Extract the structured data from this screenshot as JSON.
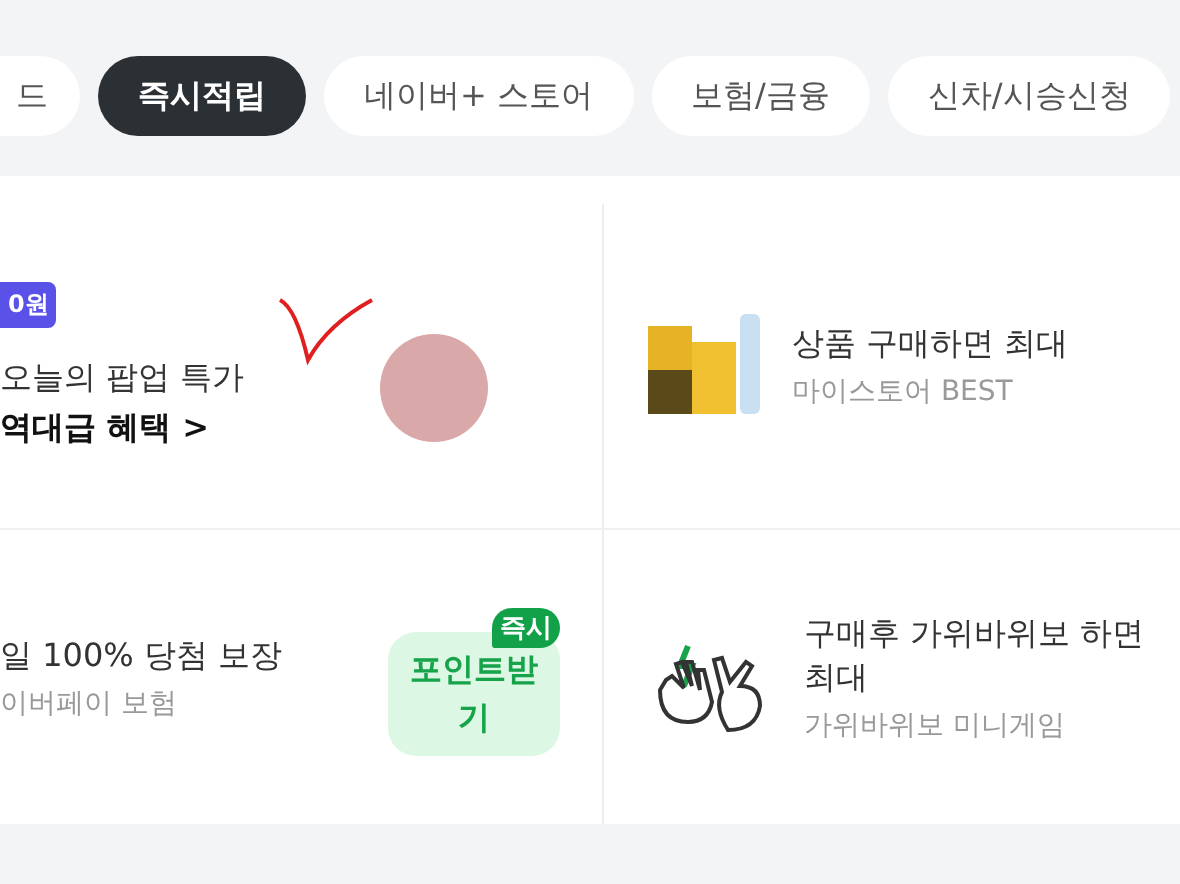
{
  "tabs": [
    {
      "label": "드",
      "selected": false
    },
    {
      "label": "즉시적립",
      "selected": true
    },
    {
      "label": "네이버+ 스토어",
      "selected": false
    },
    {
      "label": "보험/금융",
      "selected": false
    },
    {
      "label": "신차/시승신청",
      "selected": false
    }
  ],
  "offers": [
    {
      "kind": "popup",
      "badge": "0원",
      "title": "오늘의 팝업 특가",
      "subtitle": "역대급 혜택 >"
    },
    {
      "kind": "product",
      "title": "상품 구매하면 최대",
      "subtitle": "마이스토어 BEST"
    },
    {
      "kind": "insurance",
      "title": "일 100% 당첨 보장",
      "subtitle": "이버페이 보험",
      "action": {
        "label": "포인트받기",
        "tag": "즉시"
      }
    },
    {
      "kind": "game",
      "title": "구매후 가위바위보 하면 최대",
      "subtitle": "가위바위보 미니게임"
    }
  ]
}
